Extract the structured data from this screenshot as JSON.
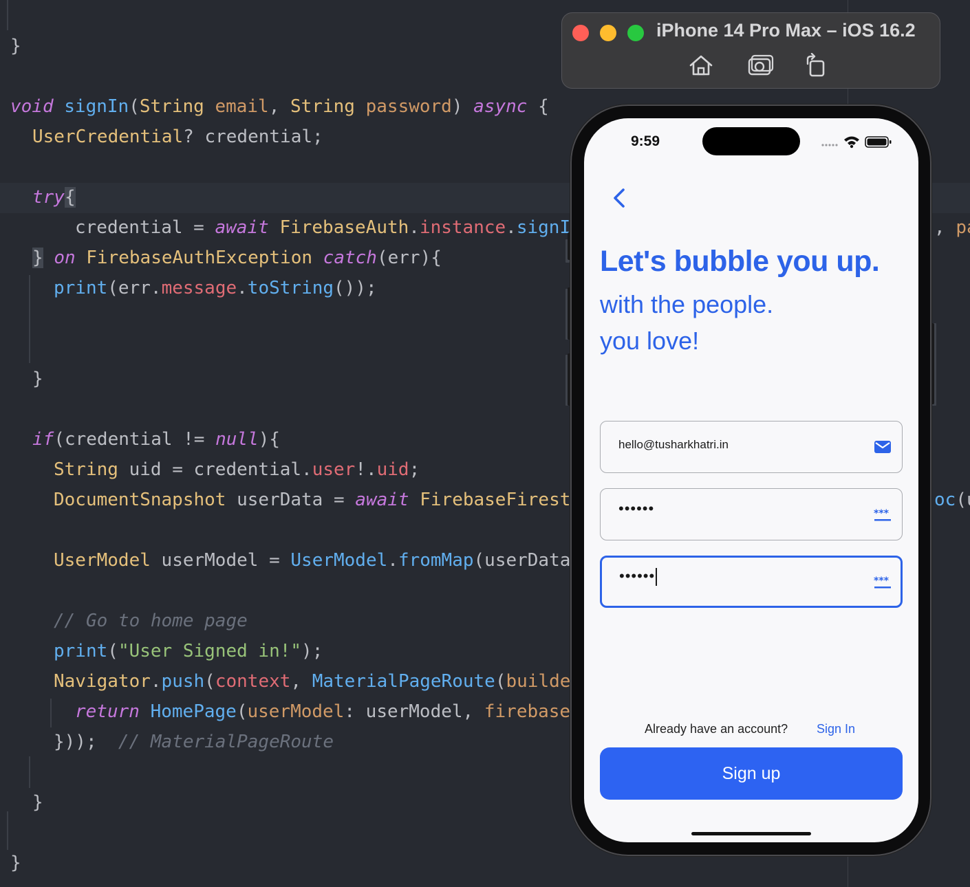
{
  "editor": {
    "lines": [
      [
        {
          "t": "}",
          "c": ""
        }
      ],
      [
        {
          "t": "void",
          "c": "k"
        },
        {
          "t": " ",
          "c": ""
        },
        {
          "t": "signIn",
          "c": "f"
        },
        {
          "t": "(",
          "c": ""
        },
        {
          "t": "String",
          "c": "t"
        },
        {
          "t": " ",
          "c": ""
        },
        {
          "t": "email",
          "c": "p"
        },
        {
          "t": ", ",
          "c": ""
        },
        {
          "t": "String",
          "c": "t"
        },
        {
          "t": " ",
          "c": ""
        },
        {
          "t": "password",
          "c": "p"
        },
        {
          "t": ") ",
          "c": ""
        },
        {
          "t": "async",
          "c": "k"
        },
        {
          "t": " {",
          "c": ""
        }
      ],
      [
        {
          "t": "UserCredential",
          "c": "t"
        },
        {
          "t": "? credential;",
          "c": ""
        }
      ],
      [
        {
          "t": "try",
          "c": "k"
        },
        {
          "t": "{",
          "c": "hl"
        }
      ],
      [
        {
          "t": "credential = ",
          "c": ""
        },
        {
          "t": "await",
          "c": "k"
        },
        {
          "t": " ",
          "c": ""
        },
        {
          "t": "FirebaseAuth",
          "c": "t"
        },
        {
          "t": ".",
          "c": ""
        },
        {
          "t": "instance",
          "c": "pr"
        },
        {
          "t": ".",
          "c": ""
        },
        {
          "t": "signI",
          "c": "f"
        }
      ],
      [
        {
          "t": "}",
          "c": "hl"
        },
        {
          "t": " ",
          "c": ""
        },
        {
          "t": "on",
          "c": "k"
        },
        {
          "t": " ",
          "c": ""
        },
        {
          "t": "FirebaseAuthException",
          "c": "t"
        },
        {
          "t": " ",
          "c": ""
        },
        {
          "t": "catch",
          "c": "k"
        },
        {
          "t": "(err){",
          "c": ""
        }
      ],
      [
        {
          "t": "print",
          "c": "f"
        },
        {
          "t": "(err.",
          "c": ""
        },
        {
          "t": "message",
          "c": "pr"
        },
        {
          "t": ".",
          "c": ""
        },
        {
          "t": "toString",
          "c": "f"
        },
        {
          "t": "());",
          "c": ""
        }
      ],
      [
        {
          "t": "}",
          "c": ""
        }
      ],
      [
        {
          "t": "if",
          "c": "k"
        },
        {
          "t": "(credential != ",
          "c": ""
        },
        {
          "t": "null",
          "c": "k"
        },
        {
          "t": "){",
          "c": ""
        }
      ],
      [
        {
          "t": "String",
          "c": "t"
        },
        {
          "t": " uid = credential.",
          "c": ""
        },
        {
          "t": "user",
          "c": "pr"
        },
        {
          "t": "!.",
          "c": ""
        },
        {
          "t": "uid",
          "c": "pr"
        },
        {
          "t": ";",
          "c": ""
        }
      ],
      [
        {
          "t": "DocumentSnapshot",
          "c": "t"
        },
        {
          "t": " userData = ",
          "c": ""
        },
        {
          "t": "await",
          "c": "k"
        },
        {
          "t": " ",
          "c": ""
        },
        {
          "t": "FirebaseFirest",
          "c": "t"
        }
      ],
      [
        {
          "t": "UserModel",
          "c": "t"
        },
        {
          "t": " userModel = ",
          "c": ""
        },
        {
          "t": "UserModel",
          "c": "f"
        },
        {
          "t": ".",
          "c": ""
        },
        {
          "t": "fromMap",
          "c": "f"
        },
        {
          "t": "(userData",
          "c": ""
        }
      ],
      [
        {
          "t": "// Go to home page",
          "c": "c"
        }
      ],
      [
        {
          "t": "print",
          "c": "f"
        },
        {
          "t": "(",
          "c": ""
        },
        {
          "t": "\"User Signed in!\"",
          "c": "s"
        },
        {
          "t": ");",
          "c": ""
        }
      ],
      [
        {
          "t": "Navigator",
          "c": "t"
        },
        {
          "t": ".",
          "c": ""
        },
        {
          "t": "push",
          "c": "f"
        },
        {
          "t": "(",
          "c": ""
        },
        {
          "t": "context",
          "c": "pr"
        },
        {
          "t": ", ",
          "c": ""
        },
        {
          "t": "MaterialPageRoute",
          "c": "f"
        },
        {
          "t": "(",
          "c": ""
        },
        {
          "t": "builde",
          "c": "p"
        }
      ],
      [
        {
          "t": "return",
          "c": "k"
        },
        {
          "t": " ",
          "c": ""
        },
        {
          "t": "HomePage",
          "c": "f"
        },
        {
          "t": "(",
          "c": ""
        },
        {
          "t": "userModel",
          "c": "p"
        },
        {
          "t": ": userModel, ",
          "c": ""
        },
        {
          "t": "firebase",
          "c": "p"
        }
      ],
      [
        {
          "t": "}));  ",
          "c": ""
        },
        {
          "t": "// MaterialPageRoute",
          "c": "c"
        }
      ],
      [
        {
          "t": "}",
          "c": ""
        }
      ],
      [
        {
          "t": "}",
          "c": ""
        }
      ]
    ],
    "right_fragments": [
      [
        {
          "t": ", ",
          "c": ""
        },
        {
          "t": "pa",
          "c": "p"
        }
      ],
      [
        {
          "t": "oc",
          "c": "f"
        },
        {
          "t": "(u",
          "c": ""
        }
      ]
    ]
  },
  "simulator": {
    "title": "iPhone 14 Pro Max – iOS 16.2",
    "toolbar_icons": [
      "home-icon",
      "screenshot-icon",
      "rotate-icon"
    ]
  },
  "app": {
    "status_time": "9:59",
    "headline": "Let's bubble you up.",
    "subline_1": "with the people.",
    "subline_2": "you love!",
    "email_value": "hello@tusharkhatri.in",
    "password_value": "••••••",
    "confirm_value": "••••••",
    "already_text": "Already have an account?",
    "signin_link": "Sign In",
    "signup_label": "Sign up",
    "accent_color": "#2d63e8"
  }
}
